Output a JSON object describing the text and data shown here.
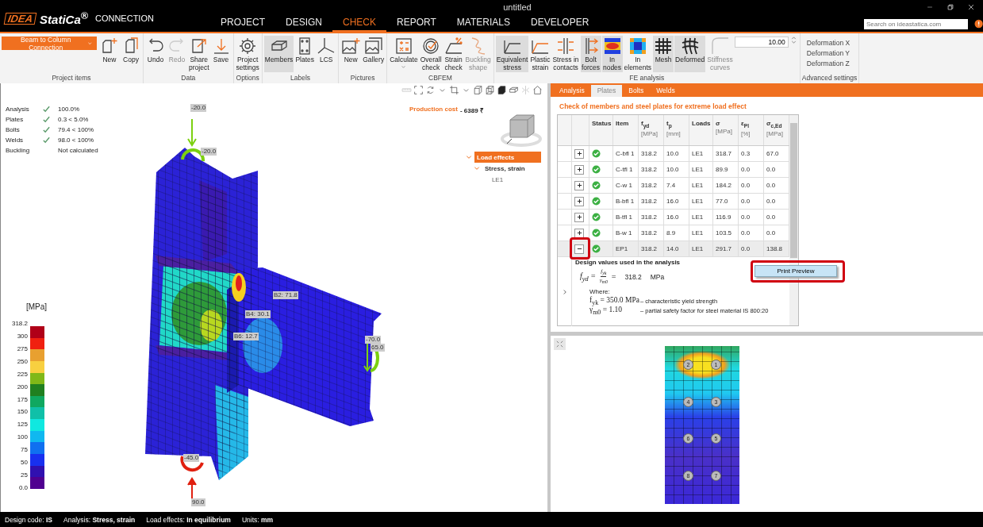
{
  "window": {
    "title": "untitled",
    "logo_box": "IDEA",
    "logo_word": "StatiCa$^{®}$",
    "product": "CONNECTION"
  },
  "menu": [
    {
      "label": "PROJECT",
      "selected": false
    },
    {
      "label": "DESIGN",
      "selected": false
    },
    {
      "label": "CHECK",
      "selected": true
    },
    {
      "label": "REPORT",
      "selected": false
    },
    {
      "label": "MATERIALS",
      "selected": false
    },
    {
      "label": "DEVELOPER",
      "selected": false
    }
  ],
  "search": {
    "placeholder": "Search on ideastatica.com"
  },
  "ribbon": {
    "groups": [
      {
        "label": "Project items",
        "dropdown": "Beam to Column Connection",
        "buttons": [
          {
            "label": "New",
            "selected": false,
            "disabled": false
          },
          {
            "label": "Copy",
            "selected": false,
            "disabled": false
          }
        ]
      },
      {
        "label": "Data",
        "buttons": [
          {
            "label": "Undo",
            "selected": false,
            "disabled": false
          },
          {
            "label": "Redo",
            "selected": false,
            "disabled": true
          },
          {
            "label": "Share\nproject",
            "selected": false,
            "disabled": false
          },
          {
            "label": "Save",
            "selected": false,
            "disabled": false
          }
        ]
      },
      {
        "label": "Options",
        "buttons": [
          {
            "label": "Project\nsettings",
            "selected": false,
            "disabled": false
          }
        ]
      },
      {
        "label": "Labels",
        "buttons": [
          {
            "label": "Members",
            "selected": true,
            "disabled": false
          },
          {
            "label": "Plates",
            "selected": false,
            "disabled": false
          },
          {
            "label": "LCS",
            "selected": false,
            "disabled": false
          }
        ]
      },
      {
        "label": "Pictures",
        "buttons": [
          {
            "label": "New",
            "selected": false,
            "disabled": false
          },
          {
            "label": "Gallery",
            "selected": false,
            "disabled": false
          }
        ]
      },
      {
        "label": "CBFEM",
        "buttons": [
          {
            "label": "Calculate",
            "selected": false,
            "disabled": false
          },
          {
            "label": "Overall\ncheck",
            "selected": false,
            "disabled": false
          },
          {
            "label": "Strain\ncheck",
            "selected": false,
            "disabled": false
          },
          {
            "label": "Buckling\nshape",
            "selected": false,
            "disabled": true
          }
        ]
      },
      {
        "label": "FE analysis",
        "buttons": [
          {
            "label": "Equivalent\nstress",
            "selected": true,
            "disabled": false
          },
          {
            "label": "Plastic\nstrain",
            "selected": false,
            "disabled": false
          },
          {
            "label": "Stress in\ncontacts",
            "selected": false,
            "disabled": false
          },
          {
            "label": "Bolt\nforces",
            "selected": true,
            "disabled": false
          },
          {
            "label": "In\nnodes",
            "selected": true,
            "disabled": false
          },
          {
            "label": "In\nelements",
            "selected": false,
            "disabled": false
          },
          {
            "label": "Mesh",
            "selected": true,
            "disabled": false
          },
          {
            "label": "Deformed",
            "selected": true,
            "disabled": false
          },
          {
            "label": "Stiffness\ncurves",
            "selected": false,
            "disabled": true
          }
        ],
        "number_field": "10.00"
      },
      {
        "label": "Advanced settings",
        "links": [
          "Deformation X",
          "Deformation Y",
          "Deformation Z"
        ]
      }
    ]
  },
  "viewport": {
    "summary": [
      {
        "label": "Analysis",
        "passed": true,
        "value": "100.0%"
      },
      {
        "label": "Plates",
        "passed": true,
        "value": "0.3 < 5.0%"
      },
      {
        "label": "Bolts",
        "passed": true,
        "value": "79.4 < 100%"
      },
      {
        "label": "Welds",
        "passed": true,
        "value": "98.0 < 100%"
      },
      {
        "label": "Buckling",
        "passed": false,
        "value": "Not calculated"
      }
    ],
    "legend": {
      "unit": "[MPa]",
      "ticks": [
        "318.2",
        "300",
        "275",
        "250",
        "225",
        "200",
        "175",
        "150",
        "125",
        "100",
        "75",
        "50",
        "25",
        "0.0"
      ]
    },
    "load_labels": [
      "-20.0",
      "-20.0",
      "B2: 71.8",
      "B4: 30.1",
      "B6: 12.7",
      "-70.0",
      "65.0",
      "-45.0",
      "90.0"
    ],
    "production_cost": {
      "label": "Production cost",
      "value": "- 6389 ₹"
    },
    "tree": [
      {
        "label": "Load effects",
        "selected": true,
        "expanded": true,
        "children": [
          {
            "label": "Stress, strain",
            "selected": false,
            "expanded": true,
            "children": [
              {
                "label": "LE1",
                "selected": false
              }
            ]
          }
        ]
      }
    ]
  },
  "results": {
    "tabs": [
      {
        "label": "Analysis",
        "selected": false
      },
      {
        "label": "Plates",
        "selected": true
      },
      {
        "label": "Bolts",
        "selected": false
      },
      {
        "label": "Welds",
        "selected": false
      }
    ],
    "heading": "Check of members and steel plates for extreme load effect",
    "status_header": "Status",
    "columns": [
      {
        "label": "Item"
      },
      {
        "label": "f$_{yd}$",
        "unit": "[MPa]"
      },
      {
        "label": "t$_{p}$",
        "unit": "[mm]"
      },
      {
        "label": "Loads"
      },
      {
        "label": "σ",
        "unit": "[MPa]"
      },
      {
        "label": "ε$_{Pl}$",
        "unit": "[%]"
      },
      {
        "label": "σ$_{c,Ed}$",
        "unit": "[MPa]"
      }
    ],
    "rows": [
      {
        "expanded": false,
        "selected": false,
        "highlighted": false,
        "passed": true,
        "cells": [
          "C-bfl 1",
          "318.2",
          "10.0",
          "LE1",
          "318.7",
          "0.3",
          "67.0"
        ]
      },
      {
        "expanded": false,
        "selected": false,
        "highlighted": false,
        "passed": true,
        "cells": [
          "C-tfl 1",
          "318.2",
          "10.0",
          "LE1",
          "89.9",
          "0.0",
          "0.0"
        ]
      },
      {
        "expanded": false,
        "selected": false,
        "highlighted": false,
        "passed": true,
        "cells": [
          "C-w 1",
          "318.2",
          "7.4",
          "LE1",
          "184.2",
          "0.0",
          "0.0"
        ]
      },
      {
        "expanded": false,
        "selected": false,
        "highlighted": false,
        "passed": true,
        "cells": [
          "B-bfl 1",
          "318.2",
          "16.0",
          "LE1",
          "77.0",
          "0.0",
          "0.0"
        ]
      },
      {
        "expanded": false,
        "selected": false,
        "highlighted": false,
        "passed": true,
        "cells": [
          "B-tfl 1",
          "318.2",
          "16.0",
          "LE1",
          "116.9",
          "0.0",
          "0.0"
        ]
      },
      {
        "expanded": false,
        "selected": false,
        "highlighted": false,
        "passed": true,
        "cells": [
          "B-w 1",
          "318.2",
          "8.9",
          "LE1",
          "103.5",
          "0.0",
          "0.0"
        ]
      },
      {
        "expanded": true,
        "selected": true,
        "highlighted": true,
        "passed": true,
        "cells": [
          "EP1",
          "318.2",
          "14.0",
          "LE1",
          "291.7",
          "0.0",
          "138.8"
        ]
      }
    ],
    "details": {
      "title": "Design values used in the analysis",
      "lhs": "f$_{yd}$ =",
      "numerator": "f$_{yk}$",
      "denominator": "γ$_{m0}$",
      "equals": "=",
      "value": "318.2",
      "unit": "MPa",
      "where": "Where:",
      "lines": [
        {
          "symbol": "f$_{yk}$ = 350.0 MPa",
          "description": "– characteristic yield strength"
        },
        {
          "symbol": "γ$_{m0}$ = 1.10",
          "description": "– partial safety factor for steel material IS 800:20"
        }
      ]
    },
    "context_menu": [
      {
        "label": "Print Preview",
        "highlighted": true
      }
    ]
  },
  "plate_view": {
    "bolts": [
      "2",
      "1",
      "4",
      "3",
      "6",
      "5",
      "8",
      "7"
    ]
  },
  "status_bar": [
    "Design code: **IS**",
    "Analysis: **Stress, strain**",
    "Load effects: **In equilibrium**",
    "Units: **mm**"
  ]
}
